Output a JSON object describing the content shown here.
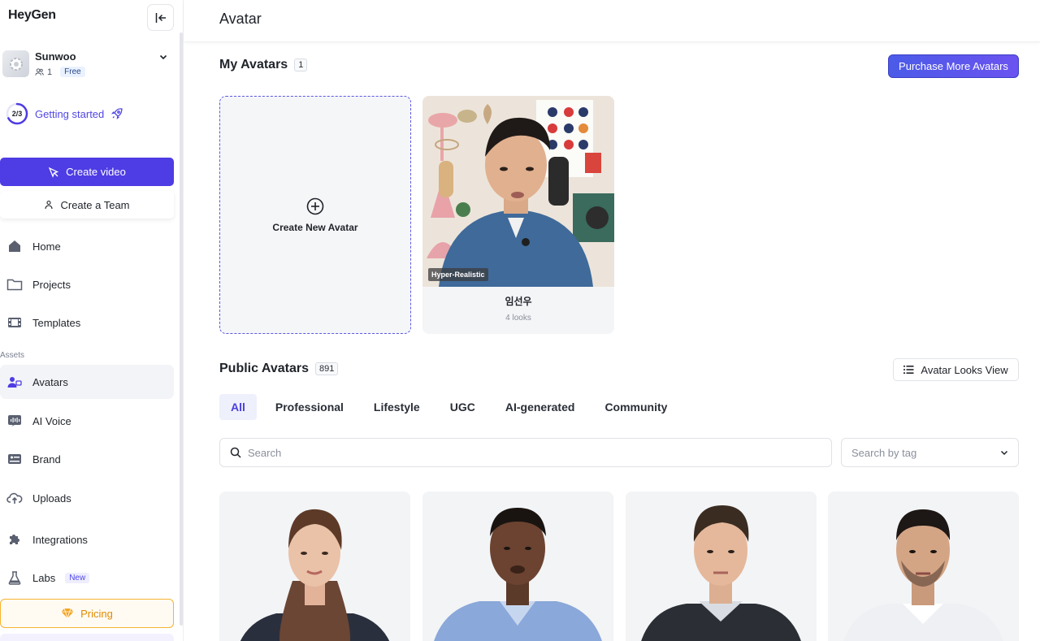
{
  "sidebar": {
    "logo": "HeyGen",
    "account": {
      "name": "Sunwoo",
      "members": "1",
      "plan": "Free"
    },
    "getting_started": {
      "progress": "2/3",
      "label": "Getting started",
      "fraction": 0.67
    },
    "create_video": "Create video",
    "create_team": "Create a Team",
    "nav": {
      "home": "Home",
      "projects": "Projects",
      "templates": "Templates",
      "assets_label": "Assets",
      "avatars": "Avatars",
      "ai_voice": "AI Voice",
      "brand": "Brand",
      "uploads": "Uploads",
      "integrations": "Integrations",
      "labs": "Labs",
      "labs_badge": "New"
    },
    "pricing": "Pricing"
  },
  "main": {
    "page_title": "Avatar",
    "my_avatars": {
      "title": "My Avatars",
      "count": "1",
      "purchase_button": "Purchase More Avatars",
      "create_new": "Create New Avatar",
      "cards": [
        {
          "name": "임선우",
          "looks": "4 looks",
          "tag": "Hyper-Realistic"
        }
      ]
    },
    "public_avatars": {
      "title": "Public Avatars",
      "count": "891",
      "looks_view_button": "Avatar Looks View",
      "tabs": [
        "All",
        "Professional",
        "Lifestyle",
        "UGC",
        "AI-generated",
        "Community"
      ],
      "active_tab": "All",
      "search_placeholder": "Search",
      "tag_placeholder": "Search by tag"
    }
  },
  "colors": {
    "accent": "#4e3ce4",
    "pricing": "#f5b431"
  }
}
